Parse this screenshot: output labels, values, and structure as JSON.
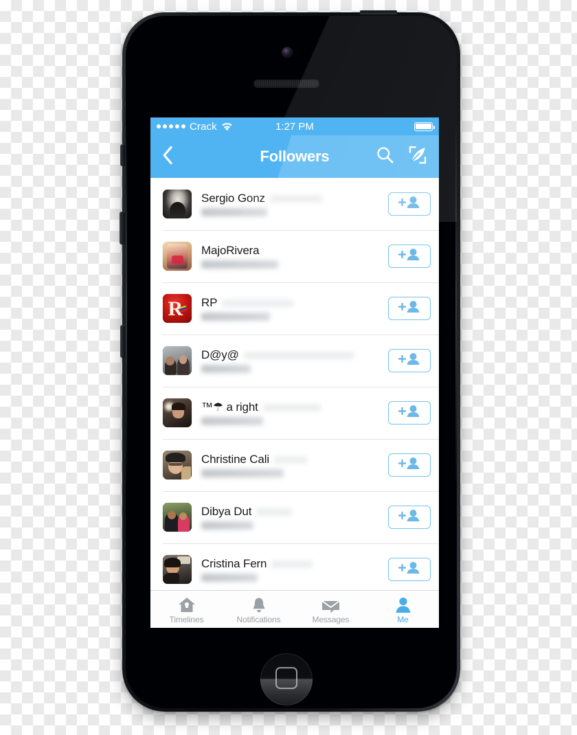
{
  "device": {
    "name": "iPhone 5",
    "home_button": "home-button",
    "buttons": [
      "mute-switch",
      "volume-up",
      "volume-down",
      "power-button"
    ]
  },
  "status_bar": {
    "signal_dots": 5,
    "carrier": "Crack",
    "wifi_icon": "wifi-icon",
    "time": "1:27 PM",
    "battery_icon": "battery-full-icon",
    "battery_level": 100,
    "background_color": "#50b4f2",
    "text_color": "#ffffff"
  },
  "nav_bar": {
    "back_icon": "chevron-left-icon",
    "title": "Followers",
    "actions": [
      {
        "name": "search-icon",
        "label": "Search"
      },
      {
        "name": "compose-icon",
        "label": "Compose"
      }
    ],
    "background_color": "#50b4f2"
  },
  "list": {
    "follow_button_icon": "add-person-icon",
    "follow_button_border_color": "#76c3ef",
    "rows": [
      {
        "name": "Sergio Gonz",
        "name_blur_width": 76,
        "handle_blur_width": 96,
        "avatar_name": "avatar-sergio-gonz"
      },
      {
        "name": "MajoRivera",
        "name_blur_width": 0,
        "handle_blur_width": 112,
        "avatar_name": "avatar-majorivera"
      },
      {
        "name": "RP",
        "name_blur_width": 104,
        "handle_blur_width": 100,
        "avatar_name": "avatar-rp"
      },
      {
        "name": "D@y@",
        "name_blur_width": 160,
        "handle_blur_width": 72,
        "avatar_name": "avatar-daya"
      },
      {
        "name": "™☂ a right",
        "name_blur_width": 84,
        "handle_blur_width": 90,
        "avatar_name": "avatar-tm-a-right"
      },
      {
        "name": "Christine Cali",
        "name_blur_width": 48,
        "handle_blur_width": 120,
        "avatar_name": "avatar-christine-cali"
      },
      {
        "name": "Dibya Dut",
        "name_blur_width": 52,
        "handle_blur_width": 76,
        "avatar_name": "avatar-dibya-dut"
      },
      {
        "name": "Cristina Fern",
        "name_blur_width": 60,
        "handle_blur_width": 82,
        "avatar_name": "avatar-cristina-fern"
      }
    ]
  },
  "tab_bar": {
    "active_color": "#4aade8",
    "inactive_color": "#9aa0a6",
    "tabs": [
      {
        "label": "Timelines",
        "icon": "home-icon",
        "active": false
      },
      {
        "label": "Notifications",
        "icon": "bell-icon",
        "active": false
      },
      {
        "label": "Messages",
        "icon": "envelope-icon",
        "active": false
      },
      {
        "label": "Me",
        "icon": "person-icon",
        "active": true
      }
    ]
  }
}
